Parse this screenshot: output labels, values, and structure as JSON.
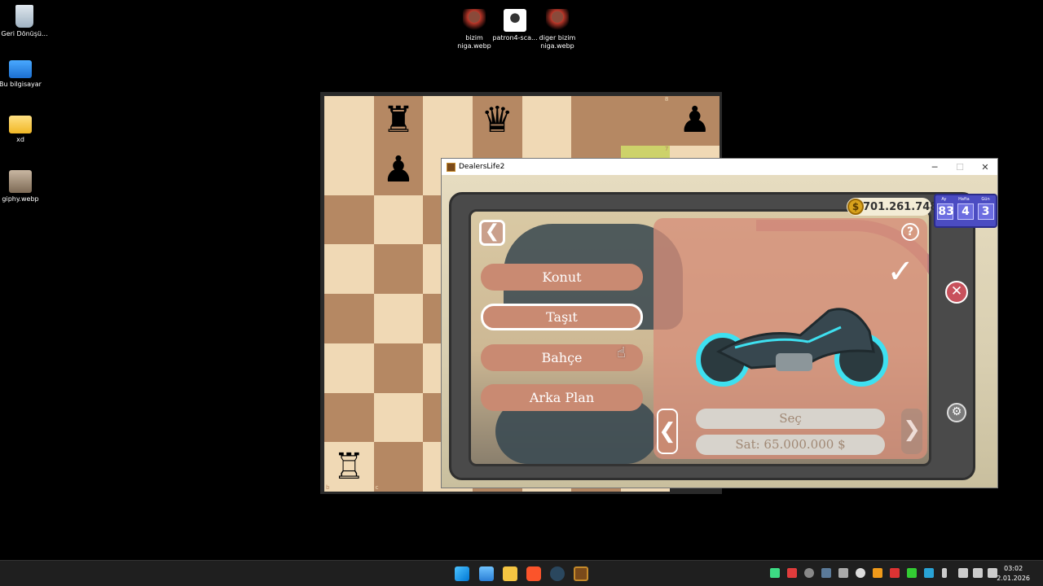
{
  "desktop": {
    "icons": [
      {
        "label": "Geri Dönüşü...",
        "icon": "recycle-bin-icon"
      },
      {
        "label": "Bu bilgisayar",
        "icon": "monitor-icon"
      },
      {
        "label": "xd",
        "icon": "folder-icon"
      },
      {
        "label": "giphy.webp",
        "icon": "image-file-icon"
      },
      {
        "label": "bizim niga.webp",
        "icon": "image-file-icon"
      },
      {
        "label": "patron4-sca...",
        "icon": "image-file-icon"
      },
      {
        "label": "diger bizim niga.webp",
        "icon": "image-file-icon"
      }
    ]
  },
  "chess": {
    "coords": {
      "rank8": "8",
      "rank7": "7",
      "file_a": "a",
      "file_b": "b",
      "file_c": "c"
    },
    "pieces": {
      "r8b": "♜",
      "q8d": "♛",
      "k8g": "♚",
      "p7a": "♟",
      "p7c": "♟",
      "P2a": "♙",
      "R1b": "♖"
    }
  },
  "game": {
    "title": "DealersLife2",
    "money": "701.261.748",
    "currency_symbol": "$",
    "date": {
      "labels": [
        "Ay",
        "Hafta",
        "Gün"
      ],
      "values": [
        "83",
        "4",
        "3"
      ]
    },
    "menu": [
      {
        "label": "Konut",
        "selected": false
      },
      {
        "label": "Taşıt",
        "selected": true
      },
      {
        "label": "Bahçe",
        "selected": false
      },
      {
        "label": "Arka Plan",
        "selected": false
      }
    ],
    "select_label": "Seç",
    "sell_label": "Sat: 65.000.000 $",
    "help": "?",
    "confirm": "✓",
    "close": "✕",
    "back": "❮",
    "prev": "❮",
    "next": "❯",
    "settings": "⚙"
  },
  "window_controls": {
    "minimize": "─",
    "maximize": "☐",
    "close": "✕"
  },
  "taskbar": {
    "time": "03:02",
    "date": "2.01.2026"
  },
  "colors": {
    "accent_salmon": "#c98a72",
    "panel_dark": "#4a4a4a",
    "date_blue": "#4b4cc2",
    "check_red": "#e01a1a"
  }
}
